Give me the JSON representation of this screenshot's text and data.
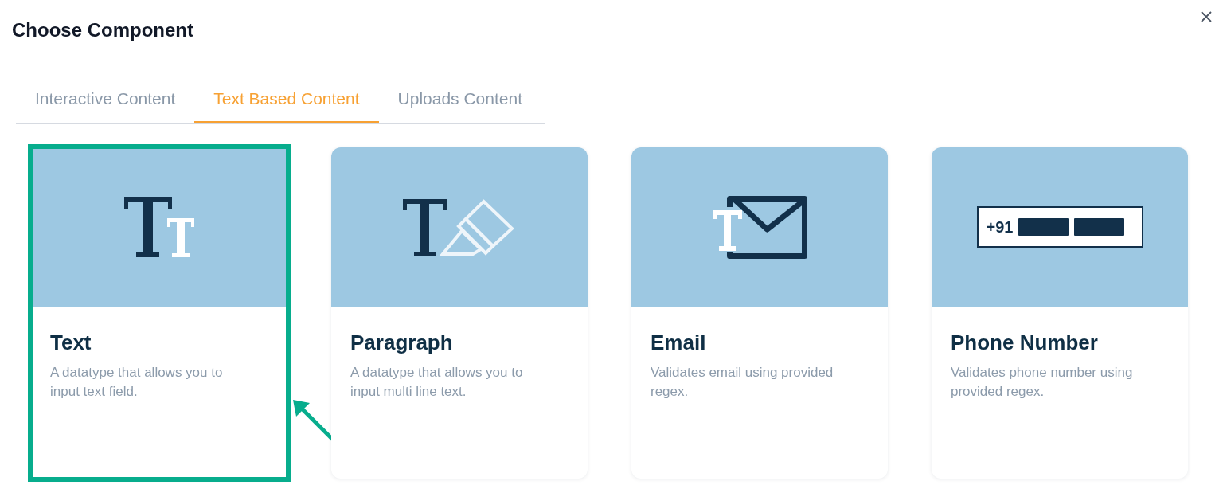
{
  "title": "Choose Component",
  "tabs": [
    {
      "label": "Interactive Content",
      "selected": false
    },
    {
      "label": "Text Based Content",
      "selected": true
    },
    {
      "label": "Uploads Content",
      "selected": false
    }
  ],
  "cards": [
    {
      "kind": "text",
      "title": "Text",
      "description": "A datatype that allows you to input text field.",
      "highlighted": true
    },
    {
      "kind": "paragraph",
      "title": "Paragraph",
      "description": "A datatype that allows you to input multi line text.",
      "highlighted": false
    },
    {
      "kind": "email",
      "title": "Email",
      "description": "Validates email using provided regex.",
      "highlighted": false
    },
    {
      "kind": "phone",
      "title": "Phone Number",
      "description": "Validates phone number using provided regex.",
      "icon_label": "+91",
      "highlighted": false
    }
  ]
}
